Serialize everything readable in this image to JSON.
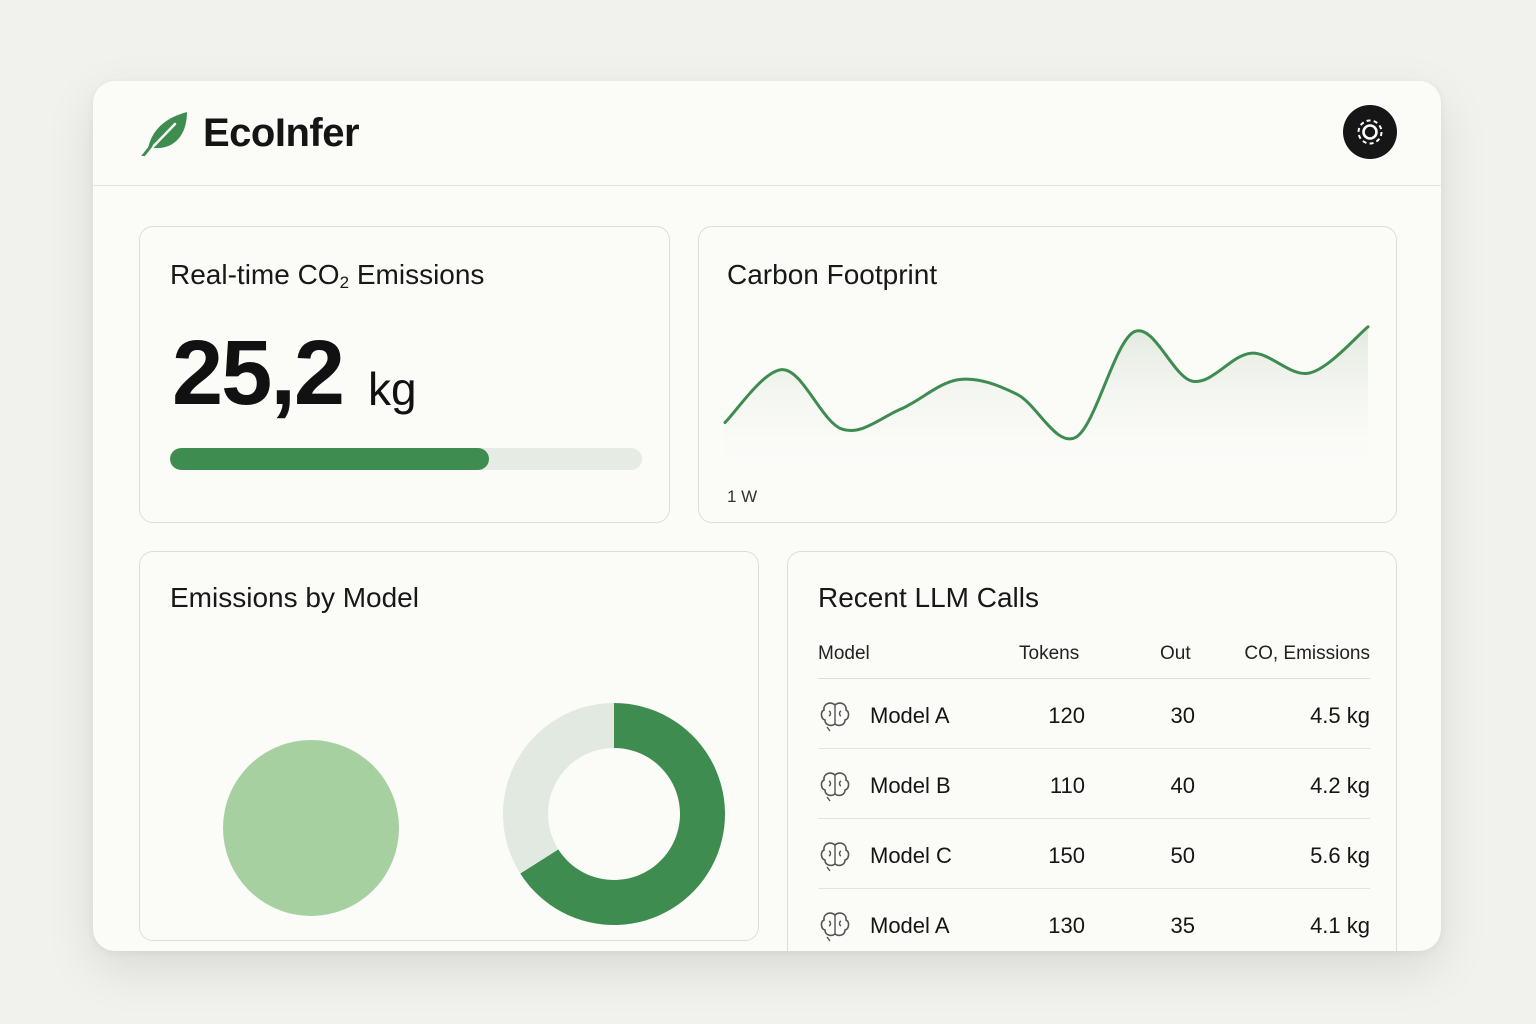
{
  "app": {
    "name": "EcoInfer",
    "settings_icon": "settings-icon",
    "logo_icon": "leaf-icon",
    "accent": "#3f8c50"
  },
  "realtime": {
    "title_main": "Real-time CO",
    "title_sub": "2",
    "title_end": " Emissions",
    "value": "25,2",
    "unit": "kg",
    "progress": 0.675
  },
  "footprint": {
    "title": "Carbon Footprint",
    "chart_data": {
      "type": "area",
      "x_label_first": "1 W",
      "values": [
        30,
        62,
        26,
        38,
        56,
        47,
        21,
        85,
        55,
        72,
        60,
        88
      ],
      "ylim": [
        0,
        100
      ],
      "grid": false
    }
  },
  "by_model": {
    "title": "Emissions by Model",
    "chart_data": {
      "type": "pie",
      "charts": [
        {
          "kind": "circle",
          "values": [
            100
          ],
          "colors": [
            "#a7d0a1"
          ]
        },
        {
          "kind": "donut",
          "values": [
            66,
            34
          ],
          "colors": [
            "#3f8c50",
            "#e2e9e0"
          ]
        }
      ]
    }
  },
  "recent_calls": {
    "title": "Recent LLM Calls",
    "columns": [
      "Model",
      "Tokens",
      "Out",
      "CO, Emissions"
    ],
    "rows": [
      {
        "icon": "brain-icon",
        "model": "Model A",
        "tokens": "120",
        "out": "30",
        "emissions": "4.5 kg"
      },
      {
        "icon": "brain-icon",
        "model": "Model B",
        "tokens": "110",
        "out": "40",
        "emissions": "4.2 kg"
      },
      {
        "icon": "brain-icon",
        "model": "Model C",
        "tokens": "150",
        "out": "50",
        "emissions": "5.6 kg"
      },
      {
        "icon": "brain-icon",
        "model": "Model A",
        "tokens": "130",
        "out": "35",
        "emissions": "4.1 kg"
      }
    ]
  }
}
